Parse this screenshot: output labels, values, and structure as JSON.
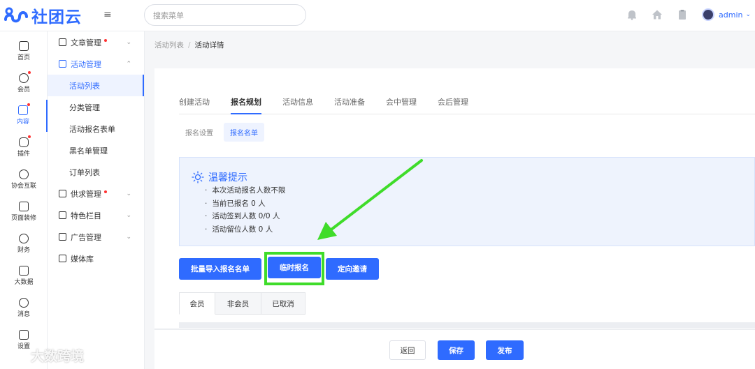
{
  "header": {
    "logo_text": "社团云",
    "menu_toggle": "≡",
    "search_placeholder": "搜索菜单",
    "user_name": "admin",
    "user_chevron": "⌄",
    "icons": [
      "bell-icon",
      "home-icon",
      "clipboard-icon"
    ]
  },
  "rail": {
    "items": [
      {
        "label": "首页",
        "icon": "home-icon",
        "badge": false,
        "active": false
      },
      {
        "label": "会员",
        "icon": "member-icon",
        "badge": true,
        "active": false
      },
      {
        "label": "内容",
        "icon": "content-icon",
        "badge": true,
        "active": true
      },
      {
        "label": "插件",
        "icon": "plugin-icon",
        "badge": true,
        "active": false
      },
      {
        "label": "协会互联",
        "icon": "network-icon",
        "badge": false,
        "active": false
      },
      {
        "label": "页面装修",
        "icon": "paint-roller-icon",
        "badge": false,
        "active": false
      },
      {
        "label": "财务",
        "icon": "yuan-icon",
        "badge": false,
        "active": false
      },
      {
        "label": "大数据",
        "icon": "data-icon",
        "badge": false,
        "active": false
      },
      {
        "label": "消息",
        "icon": "message-icon",
        "badge": false,
        "active": false
      },
      {
        "label": "设置",
        "icon": "settings-icon",
        "badge": false,
        "active": false
      }
    ]
  },
  "submenu": {
    "article": "文章管理",
    "activity": "活动管理",
    "activity_list": "活动列表",
    "category": "分类管理",
    "signup_form": "活动报名表单",
    "blacklist": "黑名单管理",
    "orders": "订单列表",
    "supply": "供求管理",
    "featured": "特色栏目",
    "ads": "广告管理",
    "media": "媒体库"
  },
  "breadcrumb": {
    "parent": "活动列表",
    "separator": "/",
    "current": "活动详情"
  },
  "tabs": [
    "创建活动",
    "报名规划",
    "活动信息",
    "活动准备",
    "会中管理",
    "会后管理"
  ],
  "active_tab": "报名规划",
  "subtabs": [
    "报名设置",
    "报名名单"
  ],
  "active_subtab": "报名名单",
  "notice": {
    "title": "温馨提示",
    "lines": [
      "本次活动报名人数不限",
      "当前已报名 0 人",
      "活动签到人数 0/0 人",
      "活动留位人数 0 人"
    ]
  },
  "actions": {
    "batch_import": "批量导入报名名单",
    "temp_signup": "临时报名",
    "targeted_invite": "定向邀请"
  },
  "member_tabs": [
    "会员",
    "非会员",
    "已取消"
  ],
  "active_member_tab": "会员",
  "footer": {
    "back": "返回",
    "save": "保存",
    "publish": "发布"
  },
  "watermark": "大数跨境",
  "colors": {
    "primary": "#2f6bff",
    "highlight": "#3fdc2a",
    "arrow": "#3fdc2a",
    "badge": "#ff3333"
  }
}
